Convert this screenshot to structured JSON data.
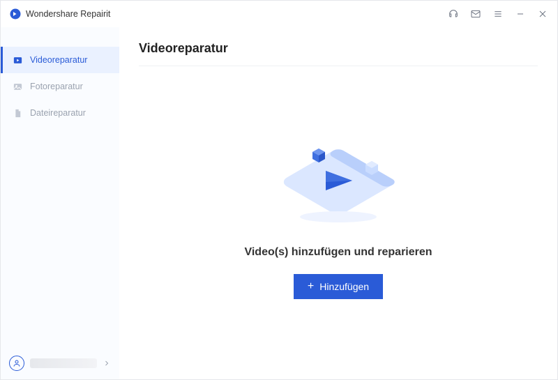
{
  "app": {
    "title": "Wondershare Repairit"
  },
  "sidebar": {
    "items": [
      {
        "label": "Videoreparatur",
        "active": true
      },
      {
        "label": "Fotoreparatur",
        "active": false
      },
      {
        "label": "Dateireparatur",
        "active": false
      }
    ]
  },
  "page": {
    "title": "Videoreparatur",
    "promptText": "Video(s) hinzufügen und reparieren",
    "addButtonLabel": "Hinzufügen"
  },
  "colors": {
    "accent": "#2a5bd7",
    "sidebarBg": "#fafcff",
    "activeBg": "#eaf1ff"
  }
}
